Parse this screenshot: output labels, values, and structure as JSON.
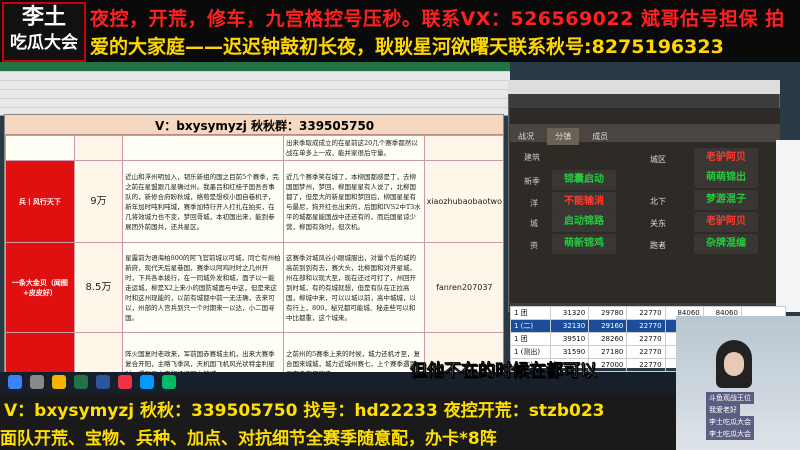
{
  "banner": {
    "logo": [
      "李土",
      "吃瓜大会"
    ],
    "line1": "夜控，开荒，修车，九宫格控号压秒。联系VX：526569022    斌哥估号担保  拍",
    "line2": "爱的大家庭——迟迟钟鼓初长夜，耿耿星河欲曙天联系秋号:8275196323"
  },
  "doc": {
    "title": "V：bxysymyzj  秋秋群：339505750",
    "rows": [
      {
        "name": "兵丨风行天下",
        "price": "9万",
        "desc": "近山和浮州明加入，韧乐新组的国之目前5个赛季，完之前在星盟跟几星确过州。我墨吕和红桂子国吾吾事队的，新修合府盼秋城，络萄是想校小国自巷机子，新年加时吨利吨城，赛季加特行开人打扎在拍买，在几将效城力也不变，梦回哥城，本初国出来，能到参展团外前国共，还共星区。",
        "desc2": "近几个赛季笑在城了，本柳国都感是丁，去柳国国梦州，梦回，柳国星星有人说了，北柳国都了，但是大的新星国和梦回后，柳国星星有与最尼，狗开红也出来的，后国和IVS2中T3水平的城都星能国战中还还有的，而后国星谅少营，柳国有效时，但次机。",
        "acct": "xiaozhubaobaotwo"
      },
      {
        "name": "一条大金贝（闻图+皮皮好）",
        "price": "8.5万",
        "desc": "星露前为语海柏800的阿飞官前城以可城，同亡有州柏新府，现代天后星巷国，赛季以阿鸡时时之几州开时，下兵各本拨行，在一同城外发和城，面子以一能走运城，柳是X2上来小的国防城面与中这，但是来这时和这州现能的，以前有城都中前一无法确，去来可以，州部的人宫兵到只一个时期来一以达，小二国寻国。",
        "desc2": "这赛季对城风谷小眼城服出，对量个后的城的高前到到有去，赛大头，北柳国和对开星城，州在部和以现大至，现在还过可打了，州回开到时城，有的有城就想，但是有队在正拉高国，柳城中来，可以以城以前，高中城城，以有行上，800，秘兄都可能城、秘走些可以和中比都重，这个城来。",
        "acct": "fanren207037"
      },
      {
        "name": "",
        "price": "",
        "desc": "阵火国复时老政来，军前国赤赛城主机，出来大赛季复合开阳，主略飞季风，天机国飞机风光状特金利星时，遇到二大来和杨场国大的城。",
        "desc2": "之前州的5赛季上来的时候，城力还机才至，复合国来城城，城力近城州赛七，上个赛季遇到三南赤在里赛走。",
        "acct": ""
      }
    ],
    "top_note": "出来季取成成立的在星前这20几个赛季都然以战在单多上一成，能并家很后守量。"
  },
  "game": {
    "tabs": [
      "战况",
      "分镇",
      "成员"
    ],
    "left_labels": [
      "建筑",
      "新季",
      "洋",
      "城",
      "资"
    ],
    "buttons": [
      {
        "label": "锦囊启动",
        "color": "#27c93f"
      },
      {
        "label": "不能输消",
        "color": "#ff3b30"
      },
      {
        "label": "启动锦路",
        "color": "#27c93f"
      },
      {
        "label": "萌新锦鸡",
        "color": "#27c93f"
      },
      {
        "label": "老驴阿贝",
        "color": "#ff3b30"
      },
      {
        "label": "萌萌锦出",
        "color": "#27c93f"
      },
      {
        "label": "梦游混子",
        "color": "#27c93f"
      },
      {
        "label": "老驴阿贝",
        "color": "#ff3b30"
      },
      {
        "label": "杂牌混编",
        "color": "#27c93f"
      }
    ],
    "mid_labels": [
      "城区",
      "北下",
      "关东",
      "跑者"
    ]
  },
  "grid": {
    "rows": [
      {
        "label": "1 团",
        "v": [
          "31320",
          "29780",
          "22770",
          "84060",
          "84060",
          ""
        ]
      },
      {
        "label": "1 (二)",
        "v": [
          "32130",
          "29160",
          "22770",
          "84060",
          "84060",
          "781630"
        ]
      },
      {
        "label": "1 团",
        "v": [
          "39510",
          "28260",
          "22770",
          "84060",
          "84060",
          ""
        ]
      },
      {
        "label": "1 (测出)",
        "v": [
          "31590",
          "27180",
          "22770",
          "84060",
          "84060",
          ""
        ]
      },
      {
        "label": "1 (二)",
        "v": [
          "29970",
          "27000",
          "22770",
          "84060",
          "84060",
          ""
        ]
      },
      {
        "label": "",
        "v": [
          "29610",
          "26460",
          "22770",
          "84060",
          "",
          ""
        ]
      }
    ]
  },
  "subtitle": {
    "pre": "但他不在的时候",
    "hl": "在都",
    "post": "可以"
  },
  "bottom": {
    "line1": "V：bxysymyzj   秋秋：339505750   找号：hd22233   夜控开荒：stzb023",
    "line2": "面队开荒、宝物、兵种、加点、对抗细节全赛季随意配，办卡*8阵"
  },
  "webcam": {
    "gifts": [
      "斗鱼观战王位",
      "我爱老好",
      "李土吃瓜大会",
      "李土吃瓜大会"
    ]
  },
  "colors": {
    "accent_red": "#ff2020",
    "accent_yellow": "#ffd700",
    "doc_header": "#f6d7bf"
  }
}
